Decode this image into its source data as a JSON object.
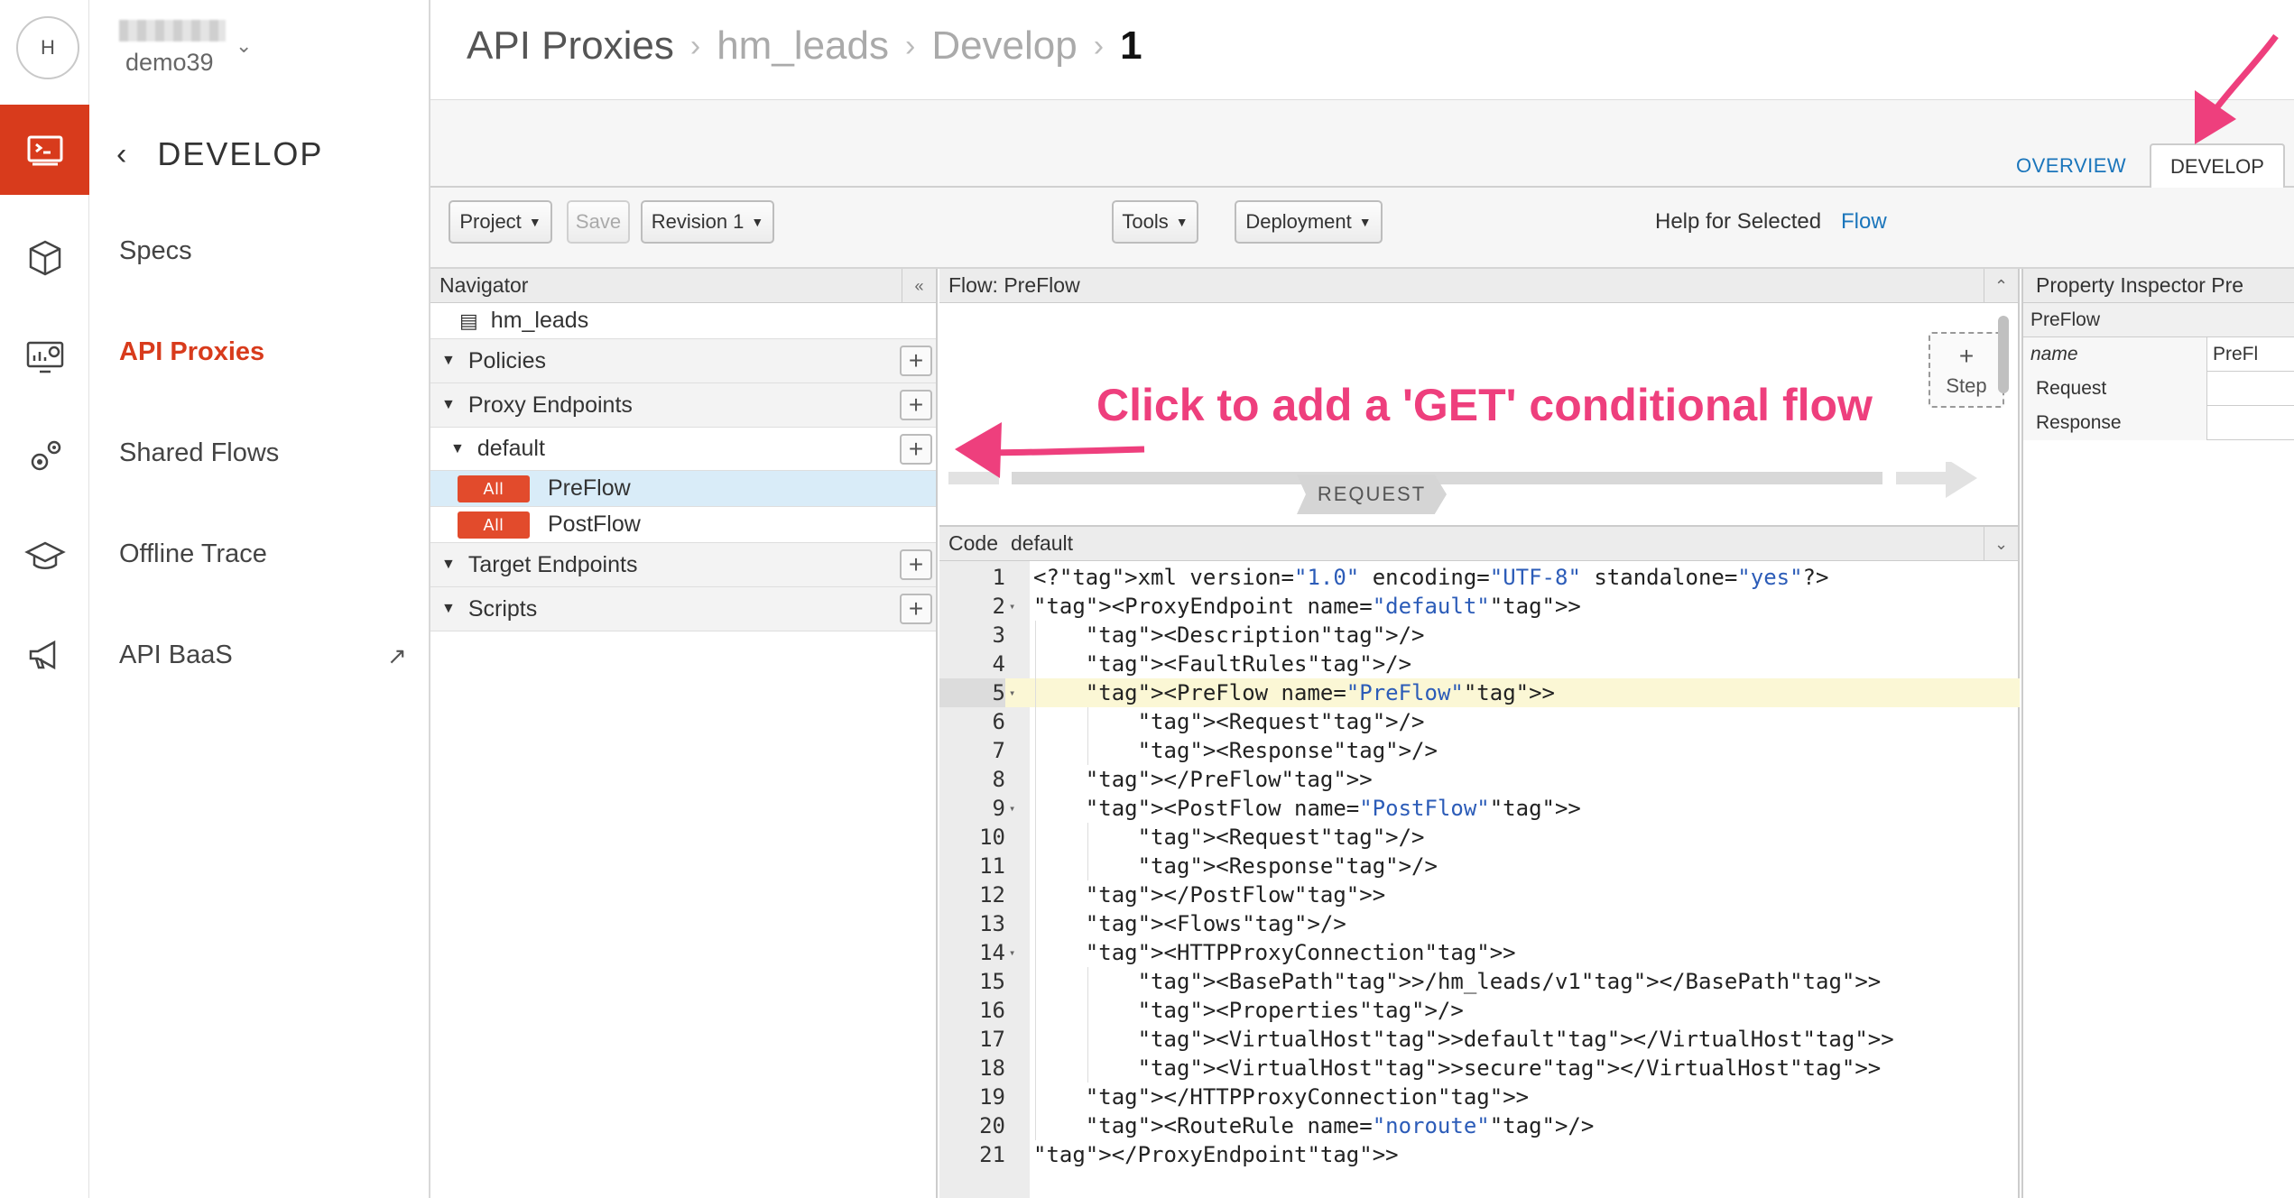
{
  "user": {
    "avatar_initial": "H",
    "org_name": "demo39"
  },
  "section_title": "DEVELOP",
  "subnav": [
    {
      "label": "Specs",
      "active": false
    },
    {
      "label": "API Proxies",
      "active": true
    },
    {
      "label": "Shared Flows",
      "active": false
    },
    {
      "label": "Offline Trace",
      "active": false
    },
    {
      "label": "API BaaS",
      "active": false,
      "external": true
    }
  ],
  "rail_icons": [
    "develop-icon",
    "package-icon",
    "analytics-icon",
    "settings-icon",
    "learn-icon",
    "publish-icon"
  ],
  "breadcrumb": [
    "API Proxies",
    "hm_leads",
    "Develop",
    "1"
  ],
  "tabs": {
    "overview": "OVERVIEW",
    "develop": "DEVELOP"
  },
  "toolbar": {
    "project": "Project",
    "save": "Save",
    "revision": "Revision 1",
    "tools": "Tools",
    "deployment": "Deployment",
    "help_label": "Help for Selected",
    "help_link": "Flow"
  },
  "navigator": {
    "title": "Navigator",
    "proxy_name": "hm_leads",
    "policies": "Policies",
    "proxy_endpoints": "Proxy Endpoints",
    "endpoint_default": "default",
    "preflow_badge": "All",
    "preflow": "PreFlow",
    "postflow_badge": "All",
    "postflow": "PostFlow",
    "target_endpoints": "Target Endpoints",
    "scripts": "Scripts"
  },
  "flow": {
    "title": "Flow: PreFlow",
    "step_label": "Step",
    "request_label": "REQUEST"
  },
  "code": {
    "title_label": "Code",
    "title_name": "default",
    "lines": [
      "<?xml version=\"1.0\" encoding=\"UTF-8\" standalone=\"yes\"?>",
      "<ProxyEndpoint name=\"default\">",
      "    <Description/>",
      "    <FaultRules/>",
      "    <PreFlow name=\"PreFlow\">",
      "        <Request/>",
      "        <Response/>",
      "    </PreFlow>",
      "    <PostFlow name=\"PostFlow\">",
      "        <Request/>",
      "        <Response/>",
      "    </PostFlow>",
      "    <Flows/>",
      "    <HTTPProxyConnection>",
      "        <BasePath>/hm_leads/v1</BasePath>",
      "        <Properties/>",
      "        <VirtualHost>default</VirtualHost>",
      "        <VirtualHost>secure</VirtualHost>",
      "    </HTTPProxyConnection>",
      "    <RouteRule name=\"noroute\"/>",
      "</ProxyEndpoint>"
    ],
    "highlight_line": 5,
    "foldable_lines": [
      2,
      5,
      9,
      14
    ]
  },
  "inspector": {
    "title": "Property Inspector  Pre",
    "section": "PreFlow",
    "rows": [
      {
        "key": "name",
        "value": "PreFl"
      },
      {
        "key": "Request",
        "value": ""
      },
      {
        "key": "Response",
        "value": ""
      }
    ]
  },
  "annotation": {
    "text": "Click to add a 'GET' conditional flow",
    "color": "#ee3f7d"
  },
  "colors": {
    "accent": "#d83b1c",
    "link": "#1a75bb",
    "badge": "#e24b2c"
  }
}
